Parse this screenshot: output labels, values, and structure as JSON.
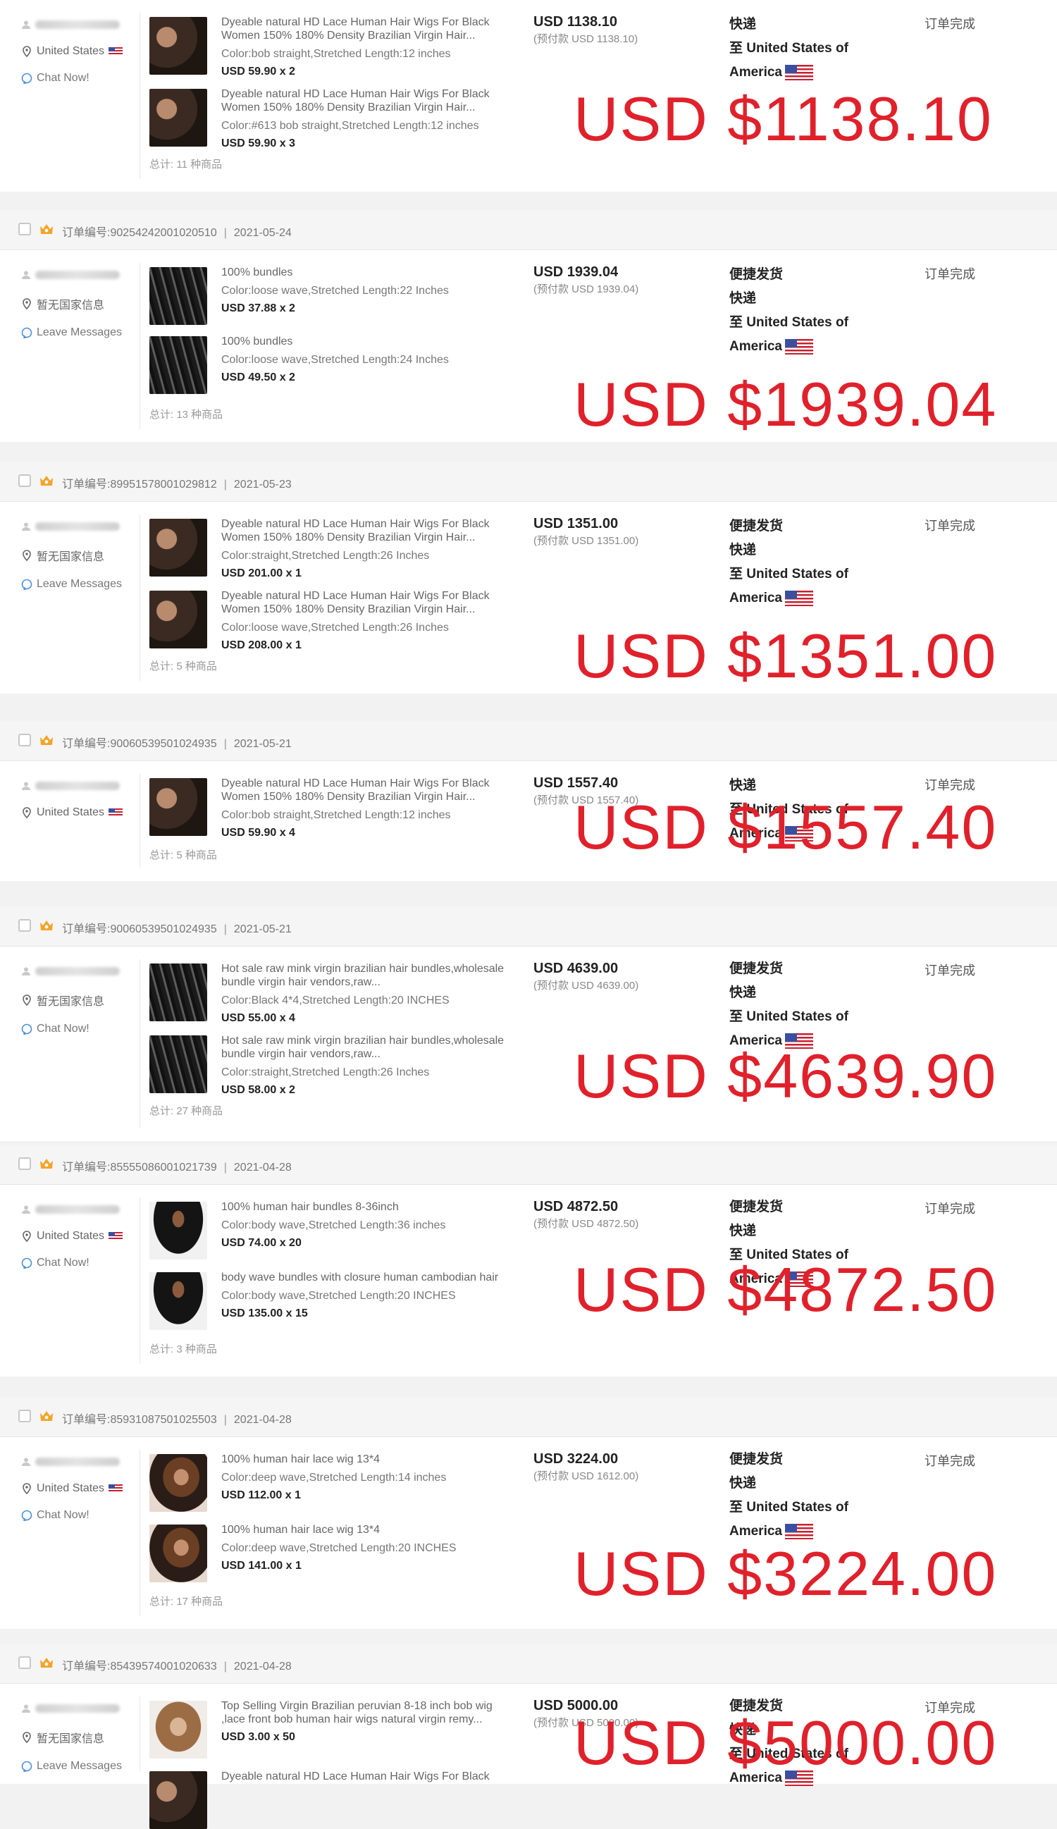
{
  "orders": [
    {
      "order_no": "",
      "date": "",
      "buyer_location": "United States",
      "buyer_contact": "Chat Now!",
      "products": [
        {
          "title": "Dyeable natural HD Lace Human Hair Wigs For Black Women 150% 180% Density Brazilian Virgin Hair...",
          "attr": "Color:bob straight,Stretched Length:12 inches",
          "price": "USD 59.90 x 2",
          "thumb": "wig"
        },
        {
          "title": "Dyeable natural HD Lace Human Hair Wigs For Black Women 150% 180% Density Brazilian Virgin Hair...",
          "attr": "Color:#613 bob straight,Stretched Length:12 inches",
          "price": "USD 59.90 x 3",
          "thumb": "wig"
        }
      ],
      "total_items": "总计: 11 种商品",
      "amount": "USD 1138.10",
      "prepaid": "(预付款 USD 1138.10)",
      "shipping": [
        "快递",
        "至 United States of",
        "America"
      ],
      "status": "订单完成",
      "big_total": "USD $1138.10"
    },
    {
      "order_no": "订单编号:90254242001020510",
      "date": "2021-05-24",
      "buyer_location": "暂无国家信息",
      "buyer_contact": "Leave Messages",
      "products": [
        {
          "title": "100% bundles",
          "attr": "Color:loose wave,Stretched Length:22 Inches",
          "price": "USD 37.88 x 2",
          "thumb": "bundle"
        },
        {
          "title": "100% bundles",
          "attr": "Color:loose wave,Stretched Length:24 Inches",
          "price": "USD 49.50 x 2",
          "thumb": "bundle"
        }
      ],
      "total_items": "总计: 13 种商品",
      "amount": "USD 1939.04",
      "prepaid": "(预付款 USD 1939.04)",
      "shipping": [
        "便捷发货",
        "快递",
        "至 United States of",
        "America"
      ],
      "status": "订单完成",
      "big_total": "USD $1939.04"
    },
    {
      "order_no": "订单编号:89951578001029812",
      "date": "2021-05-23",
      "buyer_location": "暂无国家信息",
      "buyer_contact": "Leave Messages",
      "products": [
        {
          "title": "Dyeable natural HD Lace Human Hair Wigs For Black Women 150% 180% Density Brazilian Virgin Hair...",
          "attr": "Color:straight,Stretched Length:26 Inches",
          "price": "USD 201.00 x 1",
          "thumb": "wig"
        },
        {
          "title": "Dyeable natural HD Lace Human Hair Wigs For Black Women 150% 180% Density Brazilian Virgin Hair...",
          "attr": "Color:loose wave,Stretched Length:26 Inches",
          "price": "USD 208.00 x 1",
          "thumb": "wig"
        }
      ],
      "total_items": "总计: 5 种商品",
      "amount": "USD 1351.00",
      "prepaid": "(预付款 USD 1351.00)",
      "shipping": [
        "便捷发货",
        "快递",
        "至 United States of",
        "America"
      ],
      "status": "订单完成",
      "big_total": "USD $1351.00"
    },
    {
      "order_no": "订单编号:90060539501024935",
      "date": "2021-05-21",
      "buyer_location": "United States",
      "buyer_contact": "",
      "products": [
        {
          "title": "Dyeable natural HD Lace Human Hair Wigs For Black Women 150% 180% Density Brazilian Virgin Hair...",
          "attr": "Color:bob straight,Stretched Length:12 inches",
          "price": "USD 59.90 x 4",
          "thumb": "wig"
        }
      ],
      "total_items": "总计: 5 种商品",
      "amount": "USD 1557.40",
      "prepaid": "(预付款 USD 1557.40)",
      "shipping": [
        "快递",
        "至 United States of",
        "America"
      ],
      "status": "订单完成",
      "big_total": "USD $1557.40"
    },
    {
      "order_no": "订单编号:90060539501024935",
      "date": "2021-05-21",
      "buyer_location": "暂无国家信息",
      "buyer_contact": "Chat Now!",
      "products": [
        {
          "title": "Hot sale raw mink virgin brazilian hair bundles,wholesale bundle virgin hair vendors,raw...",
          "attr": "Color:Black 4*4,Stretched Length:20 INCHES",
          "price": "USD 55.00 x 4",
          "thumb": "bundle"
        },
        {
          "title": "Hot sale raw mink virgin brazilian hair bundles,wholesale bundle virgin hair vendors,raw...",
          "attr": "Color:straight,Stretched Length:26 Inches",
          "price": "USD 58.00 x 2",
          "thumb": "bundle"
        }
      ],
      "total_items": "总计: 27 种商品",
      "amount": "USD 4639.00",
      "prepaid": "(预付款 USD 4639.00)",
      "shipping": [
        "便捷发货",
        "快递",
        "至 United States of",
        "America"
      ],
      "status": "订单完成",
      "big_total": "USD $4639.90"
    },
    {
      "order_no": "订单编号:85555086001021739",
      "date": "2021-04-28",
      "buyer_location": "United States",
      "buyer_contact": "Chat Now!",
      "products": [
        {
          "title": "100% human hair bundles 8-36inch",
          "attr": "Color:body wave,Stretched Length:36 inches",
          "price": "USD 74.00 x 20",
          "thumb": "model"
        },
        {
          "title": "body wave bundles with closure human cambodian hair",
          "attr": "Color:body wave,Stretched Length:20 INCHES",
          "price": "USD 135.00 x 15",
          "thumb": "model"
        }
      ],
      "total_items": "总计: 3 种商品",
      "amount": "USD 4872.50",
      "prepaid": "(预付款 USD 4872.50)",
      "shipping": [
        "便捷发货",
        "快递",
        "至 United States of",
        "America"
      ],
      "status": "订单完成",
      "big_total": "USD $4872.50"
    },
    {
      "order_no": "订单编号:85931087501025503",
      "date": "2021-04-28",
      "buyer_location": "United States",
      "buyer_contact": "Chat Now!",
      "products": [
        {
          "title": "100% human hair lace wig 13*4",
          "attr": "Color:deep wave,Stretched Length:14 inches",
          "price": "USD 112.00 x 1",
          "thumb": "portrait"
        },
        {
          "title": "100% human hair lace wig 13*4",
          "attr": "Color:deep wave,Stretched Length:20 INCHES",
          "price": "USD 141.00 x 1",
          "thumb": "portrait"
        }
      ],
      "total_items": "总计: 17 种商品",
      "amount": "USD 3224.00",
      "prepaid": "(预付款 USD 1612.00)",
      "shipping": [
        "便捷发货",
        "快递",
        "至 United States of",
        "America"
      ],
      "status": "订单完成",
      "big_total": "USD $3224.00"
    },
    {
      "order_no": "订单编号:85439574001020633",
      "date": "2021-04-28",
      "buyer_location": "暂无国家信息",
      "buyer_contact": "Leave Messages",
      "products": [
        {
          "title": "Top Selling Virgin Brazilian peruvian 8-18 inch bob wig ,lace front bob human hair wigs natural virgin remy...",
          "attr": "",
          "price": "USD 3.00 x 50",
          "thumb": "bob"
        },
        {
          "title": "Dyeable natural HD Lace Human Hair Wigs For Black",
          "attr": "",
          "price": "",
          "thumb": "wig"
        }
      ],
      "total_items": "",
      "amount": "USD 5000.00",
      "prepaid": "(预付款 USD 5000.00)",
      "shipping": [
        "便捷发货",
        "快递",
        "至 United States of",
        "America"
      ],
      "status": "订单完成",
      "big_total": "USD $5000.00"
    }
  ],
  "colors": {
    "accent_red": "#e0212b",
    "crown": "#f2a52b",
    "chat_blue": "#4a90d9"
  },
  "icons": {
    "crown": "crown-icon",
    "user": "user-icon",
    "pin": "location-pin-icon",
    "chat": "chat-icon",
    "flag": "us-flag-icon"
  }
}
